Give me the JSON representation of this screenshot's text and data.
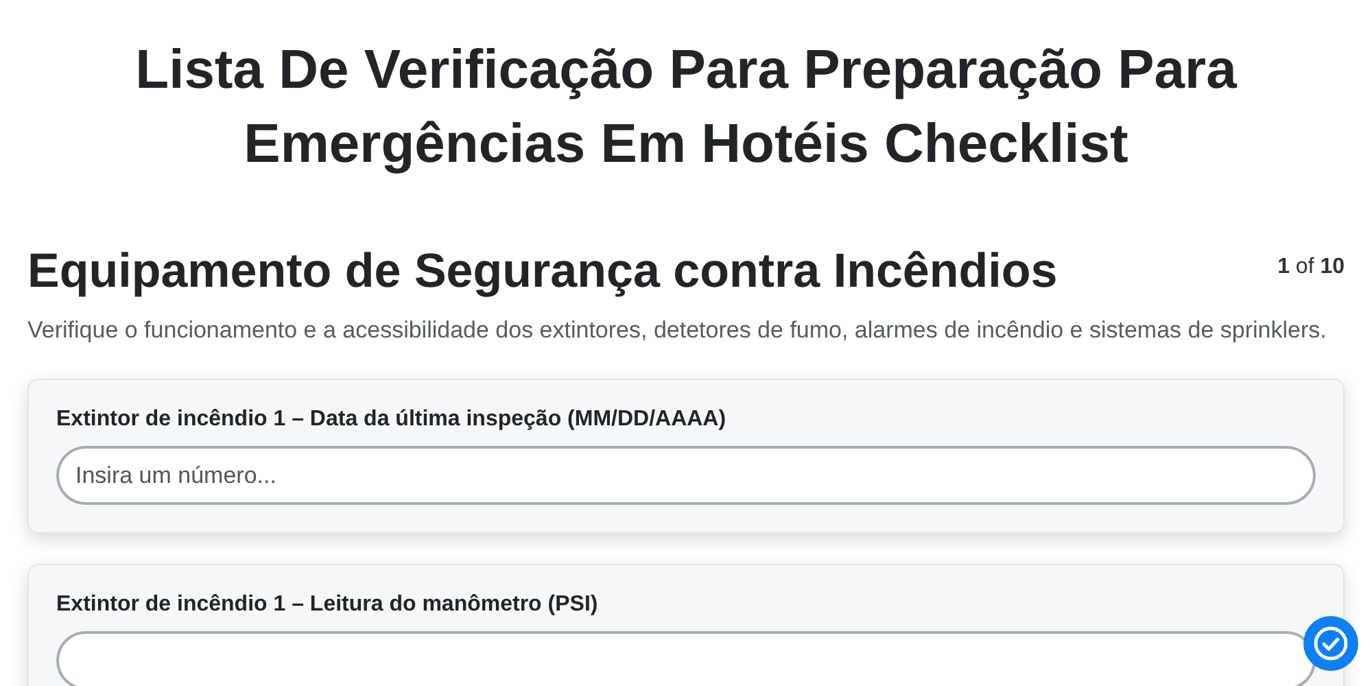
{
  "title": "Lista De Verificação Para Preparação Para Emergências Em Hotéis Checklist",
  "section": {
    "heading": "Equipamento de Segurança contra Incêndios",
    "counter": "**1** of **10**",
    "description": "Verifique o funcionamento e a acessibilidade dos extintores, detetores de fumo, alarmes de incêndio e sistemas de sprinklers."
  },
  "questions": [
    {
      "label": "Extintor de incêndio 1 – Data da última inspeção (MM/DD/AAAA)",
      "placeholder": "Insira um número..."
    },
    {
      "label": "Extintor de incêndio 1 – Leitura do manômetro (PSI)"
    }
  ]
}
